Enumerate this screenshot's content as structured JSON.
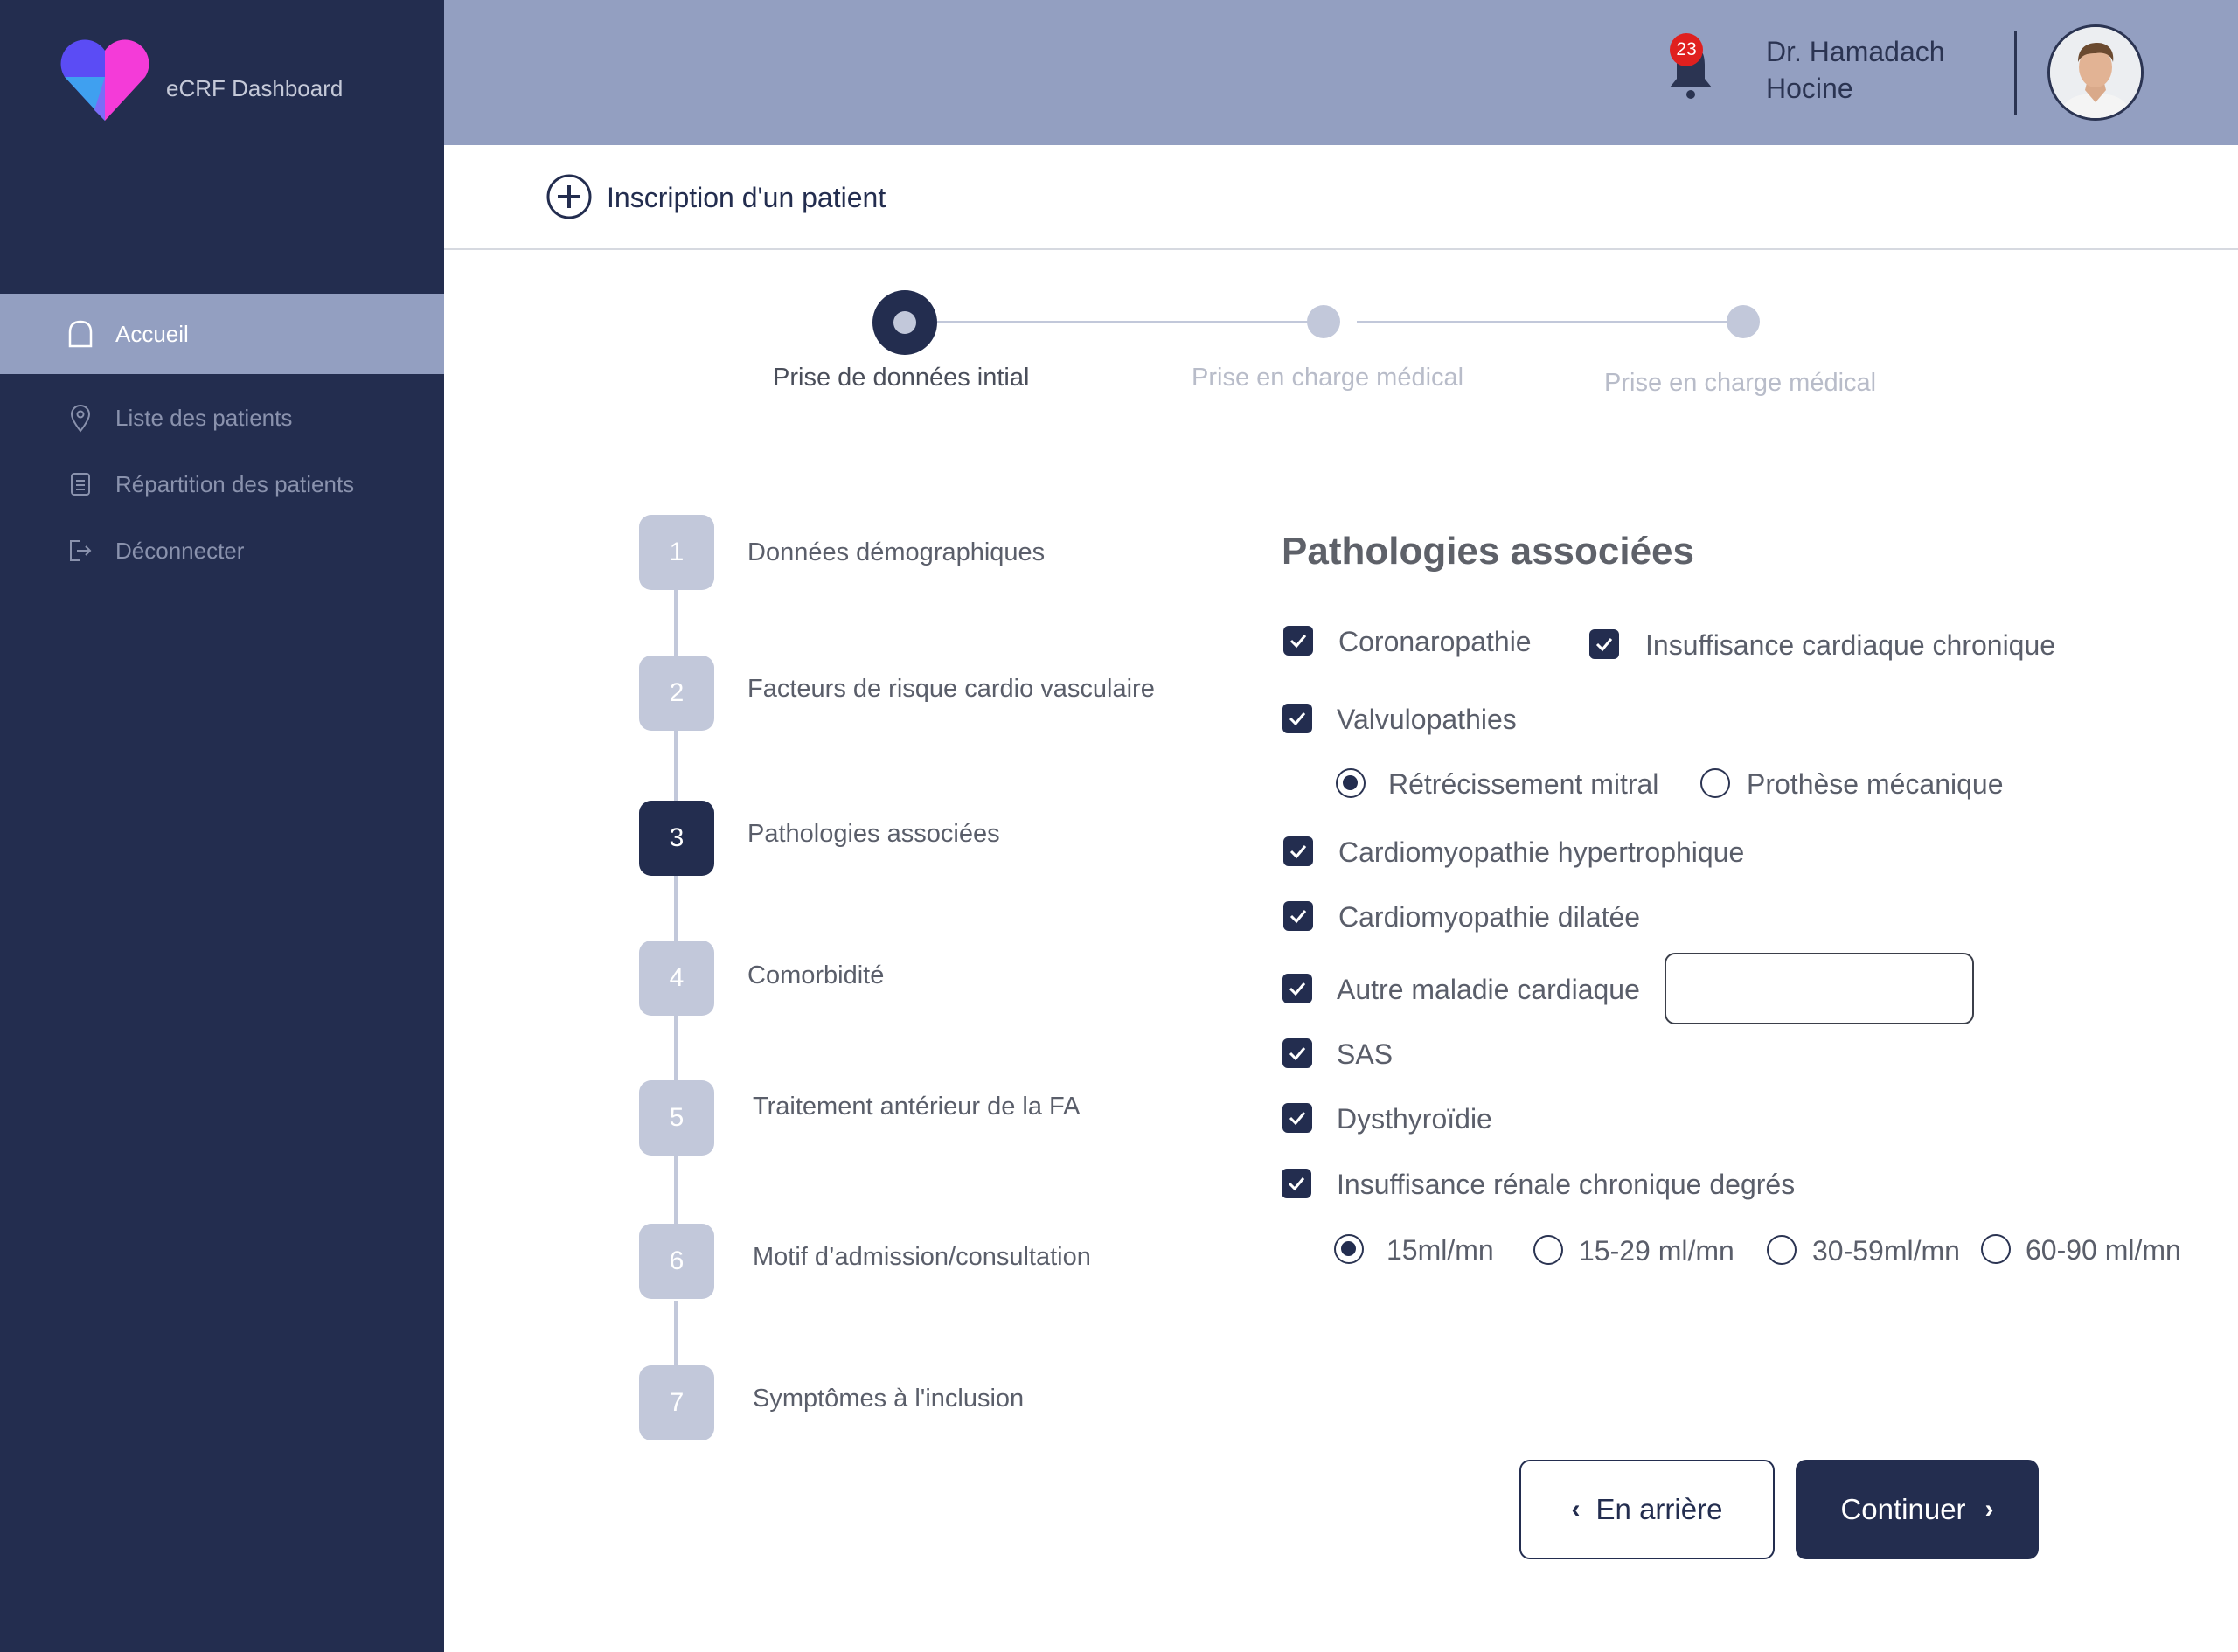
{
  "app": {
    "title": "eCRF Dashboard"
  },
  "sidebar": {
    "items": [
      {
        "label": "Accueil",
        "icon": "home-icon",
        "active": true
      },
      {
        "label": "Liste des patients",
        "icon": "location-pin-icon",
        "active": false
      },
      {
        "label": "Répartition  des patients",
        "icon": "document-list-icon",
        "active": false
      },
      {
        "label": "Déconnecter",
        "icon": "logout-icon",
        "active": false
      }
    ]
  },
  "header": {
    "notification_count": "23",
    "doctor_name_line1": "Dr. Hamadach",
    "doctor_name_line2": "Hocine"
  },
  "page": {
    "title": "Inscription d'un patient"
  },
  "stepper": {
    "steps": [
      {
        "label": "Prise de données intial",
        "state": "current"
      },
      {
        "label": "Prise en charge médical",
        "state": "pending"
      },
      {
        "label": "Prise en charge médical",
        "state": "pending"
      }
    ]
  },
  "sections": [
    {
      "number": "1",
      "label": "Données démographiques",
      "active": false
    },
    {
      "number": "2",
      "label": "Facteurs de risque cardio vasculaire",
      "active": false
    },
    {
      "number": "3",
      "label": "Pathologies associées",
      "active": true
    },
    {
      "number": "4",
      "label": "Comorbidité",
      "active": false
    },
    {
      "number": "5",
      "label": "Traitement antérieur de la FA",
      "active": false
    },
    {
      "number": "6",
      "label": "Motif d’admission/consultation",
      "active": false
    },
    {
      "number": "7",
      "label": "Symptômes à l'inclusion",
      "active": false
    }
  ],
  "form": {
    "title": "Pathologies associées",
    "checkboxes": {
      "coronaropathie": {
        "label": "Coronaropathie",
        "checked": true
      },
      "insuffisance_cardiaque": {
        "label": "Insuffisance cardiaque chronique",
        "checked": true
      },
      "valvulopathies": {
        "label": "Valvulopathies",
        "checked": true
      },
      "cardiomyopathie_hypertrophique": {
        "label": "Cardiomyopathie hypertrophique",
        "checked": true
      },
      "cardiomyopathie_dilatee": {
        "label": "Cardiomyopathie dilatée",
        "checked": true
      },
      "autre_maladie": {
        "label": "Autre maladie cardiaque",
        "checked": true,
        "value": ""
      },
      "sas": {
        "label": "SAS",
        "checked": true
      },
      "dysthyroidie": {
        "label": "Dysthyroïdie",
        "checked": true
      },
      "insuffisance_renale": {
        "label": "Insuffisance rénale chronique degrés",
        "checked": true
      }
    },
    "valvulopathie_options": [
      {
        "label": "Rétrécissement mitral",
        "selected": true
      },
      {
        "label": "Prothèse mécanique",
        "selected": false
      }
    ],
    "renal_options": [
      {
        "label": "15ml/mn",
        "selected": true
      },
      {
        "label": "15-29 ml/mn",
        "selected": false
      },
      {
        "label": "30-59ml/mn",
        "selected": false
      },
      {
        "label": "60-90  ml/mn",
        "selected": false
      }
    ]
  },
  "buttons": {
    "back_label": "En arrière",
    "continue_label": "Continuer"
  },
  "colors": {
    "sidebar": "#232d4f",
    "header": "#939fc1",
    "accent": "#232d4f",
    "inactive_step": "#c2c8da",
    "badge": "#e0201f",
    "logo_blue": "#5b4cf5",
    "logo_pink": "#f43bd8"
  }
}
